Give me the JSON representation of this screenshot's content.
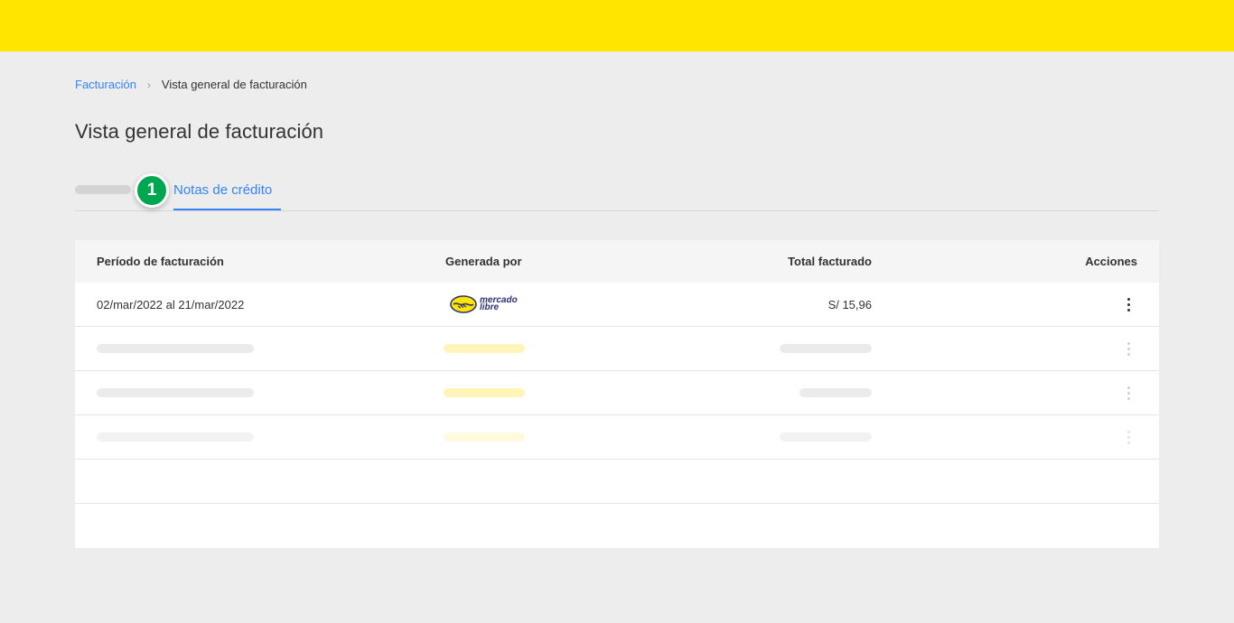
{
  "breadcrumb": {
    "parent": "Facturación",
    "separator": "›",
    "current": "Vista general de facturación"
  },
  "page_title": "Vista general de facturación",
  "tabs": {
    "step_badge": "1",
    "active_label": "Notas de crédito"
  },
  "table": {
    "headers": {
      "period": "Período de facturación",
      "generated_by": "Generada por",
      "total": "Total facturado",
      "actions": "Acciones"
    },
    "rows": [
      {
        "period": "02/mar/2022 al 21/mar/2022",
        "generated_by_logo_line1": "mercado",
        "generated_by_logo_line2": "libre",
        "total": "S/ 15,96"
      }
    ]
  },
  "colors": {
    "brand_yellow": "#ffe600",
    "accent_blue": "#3483fa",
    "step_green": "#00a650",
    "logo_navy": "#2d3277"
  },
  "icons": {
    "step": "step-number-badge",
    "actions": "kebab-menu-icon",
    "brand": "mercado-libre-handshake-icon",
    "separator": "chevron-right-icon"
  }
}
